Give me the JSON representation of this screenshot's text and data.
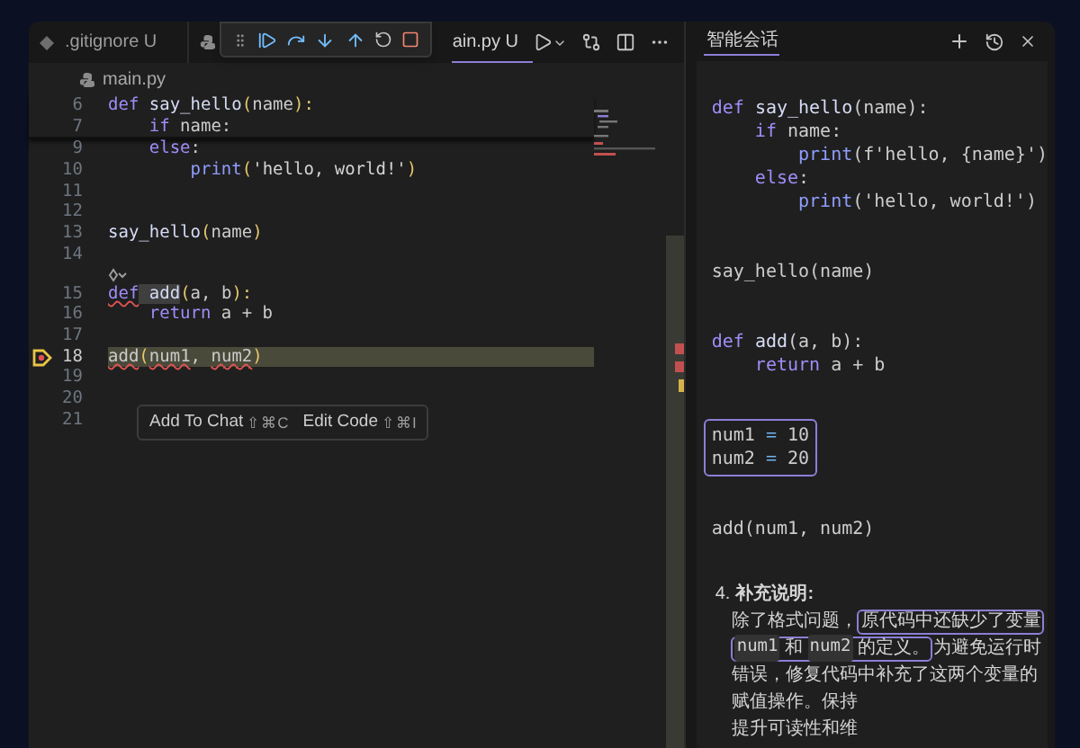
{
  "tabs": [
    {
      "label": ".gitignore U",
      "kind": "git",
      "selected": false
    },
    {
      "label": "ain.py U",
      "kind": "python",
      "selected": true
    }
  ],
  "breadcrumb": "main.py",
  "editor": {
    "sticky_lines": [
      {
        "number": "6",
        "current": false,
        "tokens": [
          {
            "kind": "kw",
            "text": "def "
          },
          {
            "kind": "fn",
            "text": "say_hello"
          },
          {
            "kind": "punc",
            "text": "("
          },
          {
            "kind": "plain",
            "text": "name"
          },
          {
            "kind": "punc",
            "text": "):"
          }
        ]
      },
      {
        "number": "7",
        "current": false,
        "tokens": [
          {
            "kind": "kw",
            "text": "    if "
          },
          {
            "kind": "plain",
            "text": "name:"
          }
        ]
      }
    ],
    "lines": [
      {
        "kind": "code",
        "number": "9",
        "current": false,
        "tokens": [
          {
            "kind": "kw",
            "text": "    else"
          },
          {
            "kind": "plain",
            "text": ":"
          }
        ]
      },
      {
        "kind": "code",
        "number": "10",
        "current": false,
        "tokens": [
          {
            "kind": "bi",
            "text": "        print"
          },
          {
            "kind": "punc",
            "text": "("
          },
          {
            "kind": "str",
            "text": "'hello, world!'"
          },
          {
            "kind": "punc",
            "text": ")"
          }
        ]
      },
      {
        "kind": "code",
        "number": "11",
        "current": false
      },
      {
        "kind": "code",
        "number": "12",
        "current": false
      },
      {
        "kind": "code",
        "number": "13",
        "current": false,
        "tokens": [
          {
            "kind": "fn",
            "text": "say_hello"
          },
          {
            "kind": "punc",
            "text": "("
          },
          {
            "kind": "plain",
            "text": "name"
          },
          {
            "kind": "punc",
            "text": ")"
          }
        ]
      },
      {
        "kind": "code",
        "number": "14",
        "current": false
      },
      {
        "kind": "codelens"
      },
      {
        "kind": "code",
        "number": "15",
        "current": false,
        "tokens": [
          {
            "kind": "kwerr",
            "text": "def"
          },
          {
            "kind": "fnhl",
            "text": " add"
          },
          {
            "kind": "punc",
            "text": "("
          },
          {
            "kind": "plain",
            "text": "a, b"
          },
          {
            "kind": "punc",
            "text": "):"
          }
        ]
      },
      {
        "kind": "code",
        "number": "16",
        "current": false,
        "tokens": [
          {
            "kind": "kw",
            "text": "    return "
          },
          {
            "kind": "plain",
            "text": "a + b"
          }
        ]
      },
      {
        "kind": "code",
        "number": "17",
        "current": false
      },
      {
        "kind": "code",
        "number": "18",
        "current": true,
        "tokens": [
          {
            "kind": "err",
            "text": "add"
          },
          {
            "kind": "punc",
            "text": "("
          },
          {
            "kind": "err",
            "text": "num1"
          },
          {
            "kind": "plain",
            "text": ", "
          },
          {
            "kind": "err",
            "text": "num2"
          },
          {
            "kind": "punc",
            "text": ")"
          }
        ]
      },
      {
        "kind": "code",
        "number": "19",
        "current": false
      },
      {
        "kind": "code",
        "number": "20",
        "current": false
      },
      {
        "kind": "code",
        "number": "21",
        "current": false
      }
    ],
    "popup": [
      {
        "label": "Add To Chat",
        "shortcut": "⇧⌘C"
      },
      {
        "label": "Edit Code",
        "shortcut": "⇧⌘I"
      }
    ]
  },
  "chat": {
    "title": "智能会话",
    "blocks": [
      {
        "boxed": false,
        "lines": [
          [
            {
              "kind": "kw",
              "text": "def "
            },
            {
              "kind": "fn",
              "text": "say_hello"
            },
            {
              "kind": "plain",
              "text": "(name):"
            }
          ],
          [
            {
              "kind": "kw",
              "text": "    if "
            },
            {
              "kind": "plain",
              "text": "name:"
            }
          ],
          [
            {
              "kind": "bi",
              "text": "        print"
            },
            {
              "kind": "plain",
              "text": "(f'hello, {name}')"
            }
          ],
          [
            {
              "kind": "kw",
              "text": "    else"
            },
            {
              "kind": "plain",
              "text": ":"
            }
          ],
          [
            {
              "kind": "bi",
              "text": "        print"
            },
            {
              "kind": "plain",
              "text": "('hello, world!')"
            }
          ]
        ]
      },
      {
        "boxed": false,
        "lines": [
          [
            {
              "kind": "plain",
              "text": "say_hello(name)"
            }
          ]
        ]
      },
      {
        "boxed": false,
        "lines": [
          [
            {
              "kind": "kw",
              "text": "def "
            },
            {
              "kind": "fn",
              "text": "add"
            },
            {
              "kind": "plain",
              "text": "(a, b):"
            }
          ],
          [
            {
              "kind": "kw",
              "text": "    return "
            },
            {
              "kind": "plain",
              "text": "a + b"
            }
          ]
        ]
      },
      {
        "boxed": true,
        "lines": [
          [
            {
              "kind": "plain",
              "text": "num1 "
            },
            {
              "kind": "op",
              "text": "="
            },
            {
              "kind": "plain",
              "text": " 10"
            }
          ],
          [
            {
              "kind": "plain",
              "text": "num2 "
            },
            {
              "kind": "op",
              "text": "="
            },
            {
              "kind": "plain",
              "text": " 20"
            }
          ]
        ]
      },
      {
        "boxed": false,
        "lines": [
          [
            {
              "kind": "plain",
              "text": "add(num1, num2)"
            }
          ]
        ]
      }
    ],
    "note": {
      "marker": "4.",
      "heading": "补充说明:",
      "lines": [
        [
          {
            "kind": "text",
            "text": "除了格式问题，"
          },
          {
            "kind": "box",
            "parts": [
              {
                "kind": "text",
                "text": "原代码中还缺少了变量"
              }
            ]
          }
        ],
        [
          {
            "kind": "box",
            "parts": [
              {
                "kind": "code",
                "text": "num1"
              },
              {
                "kind": "text",
                "text": " 和 "
              },
              {
                "kind": "code",
                "text": "num2"
              },
              {
                "kind": "text",
                "text": " 的定义。"
              }
            ]
          },
          {
            "kind": "text",
            "text": "为避免运行时"
          }
        ],
        [
          {
            "kind": "text",
            "text": "错误，修复代码中补充了这两个变量的"
          }
        ],
        [
          {
            "kind": "text",
            "text": "赋值操作。保持"
          }
        ],
        [
          {
            "kind": "text",
            "text": "提升可读性和维"
          }
        ]
      ]
    }
  }
}
